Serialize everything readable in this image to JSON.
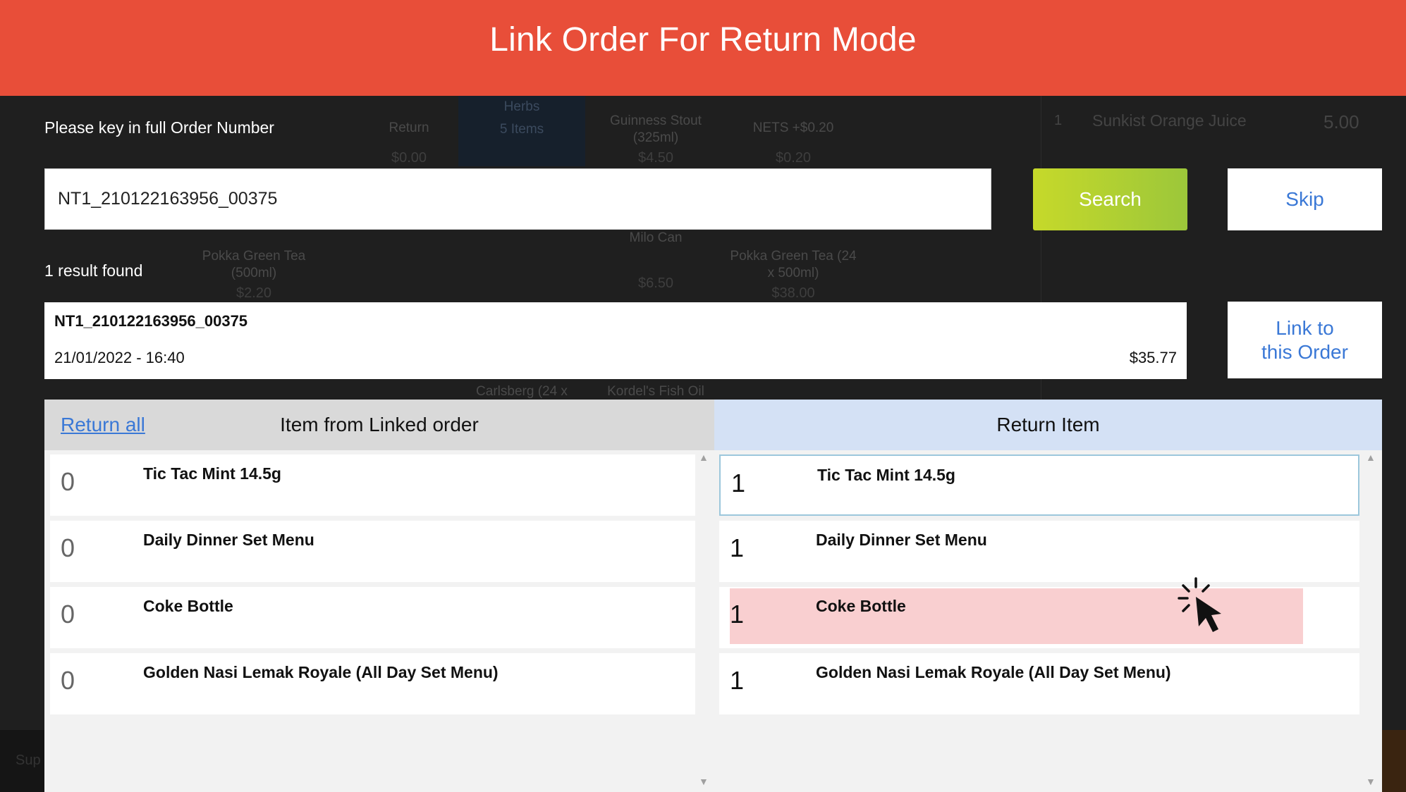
{
  "header": {
    "title": "Link Order For Return Mode"
  },
  "search": {
    "prompt": "Please key in full Order Number",
    "value": "NT1_210122163956_00375",
    "search_label": "Search",
    "skip_label": "Skip"
  },
  "results": {
    "count_text": "1 result found",
    "items": [
      {
        "order_id": "NT1_210122163956_00375",
        "datetime": "21/01/2022 - 16:40",
        "amount": "$35.77"
      }
    ],
    "link_label_line1": "Link to",
    "link_label_line2": "this Order"
  },
  "linked_panel": {
    "return_all_label": "Return all",
    "title": "Item from Linked order",
    "items": [
      {
        "qty": "0",
        "name": "Tic Tac Mint 14.5g"
      },
      {
        "qty": "0",
        "name": "Daily Dinner Set Menu"
      },
      {
        "qty": "0",
        "name": "Coke Bottle"
      },
      {
        "qty": "0",
        "name": "Golden Nasi Lemak Royale (All Day Set Menu)"
      }
    ]
  },
  "return_panel": {
    "title": "Return Item",
    "items": [
      {
        "qty": "1",
        "name": "Tic Tac Mint 14.5g"
      },
      {
        "qty": "1",
        "name": "Daily Dinner Set Menu"
      },
      {
        "qty": "1",
        "name": "Coke Bottle"
      },
      {
        "qty": "1",
        "name": "Golden Nasi Lemak Royale (All Day Set Menu)"
      }
    ]
  },
  "background": {
    "tiles": [
      {
        "label": "Return",
        "price": "$0.00"
      },
      {
        "label": "Herbs",
        "sub": "5 Items"
      },
      {
        "label": "Guinness Stout (325ml)",
        "price": "$4.50"
      },
      {
        "label": "NETS +$0.20",
        "price": "$0.20"
      },
      {
        "label": "Pokka Green Tea (500ml)",
        "price": "$2.20"
      },
      {
        "label": "Milo Can",
        "price": "$6.50"
      },
      {
        "label": "Pokka Green Tea (24 x 500ml)",
        "price": "$38.00"
      },
      {
        "label": "Carlsberg (24 x"
      },
      {
        "label": "Kordel's Fish Oil"
      },
      {
        "label": "Sup"
      }
    ],
    "cart_item": {
      "qty": "1",
      "name": "Sunkist Orange Juice",
      "price": "5.00"
    }
  },
  "colors": {
    "header": "#e84e39",
    "search_button": "#b5d130",
    "link_text": "#3a78d6",
    "highlight": "#f9cfd0",
    "return_header": "#d4e1f5"
  },
  "icons": {
    "cursor": "hand-pointer-click-icon",
    "scroll": "chevron-up-icon"
  }
}
